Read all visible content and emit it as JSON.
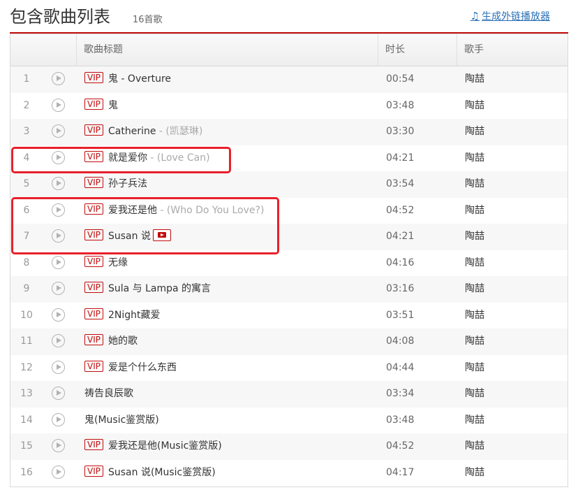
{
  "header": {
    "title": "包含歌曲列表",
    "count": "16首歌",
    "external_player_link": "生成外链播放器"
  },
  "table": {
    "columns": [
      "",
      "歌曲标题",
      "时长",
      "歌手"
    ],
    "vip_badge": "VIP",
    "rows": [
      {
        "num": "1",
        "vip": true,
        "title": "鬼 - Overture",
        "alias": "",
        "mv": false,
        "duration": "00:54",
        "artist": "陶喆"
      },
      {
        "num": "2",
        "vip": true,
        "title": "鬼",
        "alias": "",
        "mv": false,
        "duration": "03:48",
        "artist": "陶喆"
      },
      {
        "num": "3",
        "vip": true,
        "title": "Catherine",
        "alias": " - (凯瑟琳)",
        "mv": false,
        "duration": "03:30",
        "artist": "陶喆"
      },
      {
        "num": "4",
        "vip": true,
        "title": "就是爱你",
        "alias": " - (Love Can)",
        "mv": false,
        "duration": "04:21",
        "artist": "陶喆"
      },
      {
        "num": "5",
        "vip": true,
        "title": "孙子兵法",
        "alias": "",
        "mv": false,
        "duration": "03:54",
        "artist": "陶喆"
      },
      {
        "num": "6",
        "vip": true,
        "title": "爱我还是他",
        "alias": " - (Who Do You Love?)",
        "mv": false,
        "duration": "04:52",
        "artist": "陶喆"
      },
      {
        "num": "7",
        "vip": true,
        "title": "Susan 说",
        "alias": "",
        "mv": true,
        "duration": "04:21",
        "artist": "陶喆"
      },
      {
        "num": "8",
        "vip": true,
        "title": "无缘",
        "alias": "",
        "mv": false,
        "duration": "04:16",
        "artist": "陶喆"
      },
      {
        "num": "9",
        "vip": true,
        "title": "Sula 与 Lampa 的寓言",
        "alias": "",
        "mv": false,
        "duration": "03:16",
        "artist": "陶喆"
      },
      {
        "num": "10",
        "vip": true,
        "title": "2Night藏爱",
        "alias": "",
        "mv": false,
        "duration": "03:51",
        "artist": "陶喆"
      },
      {
        "num": "11",
        "vip": true,
        "title": "她的歌",
        "alias": "",
        "mv": false,
        "duration": "04:08",
        "artist": "陶喆"
      },
      {
        "num": "12",
        "vip": true,
        "title": "爱是个什么东西",
        "alias": "",
        "mv": false,
        "duration": "04:44",
        "artist": "陶喆"
      },
      {
        "num": "13",
        "vip": false,
        "title": "祷告良辰歌",
        "alias": "",
        "mv": false,
        "duration": "03:34",
        "artist": "陶喆"
      },
      {
        "num": "14",
        "vip": false,
        "title": "鬼(Music鉴赏版)",
        "alias": "",
        "mv": false,
        "duration": "03:48",
        "artist": "陶喆"
      },
      {
        "num": "15",
        "vip": true,
        "title": "爱我还是他(Music鉴赏版)",
        "alias": "",
        "mv": false,
        "duration": "04:52",
        "artist": "陶喆"
      },
      {
        "num": "16",
        "vip": true,
        "title": "Susan 说(Music鉴赏版)",
        "alias": "",
        "mv": false,
        "duration": "04:17",
        "artist": "陶喆"
      }
    ]
  },
  "colors": {
    "accent": "#c20c0c",
    "highlight_box": "#e8202a",
    "link": "#2b70b7"
  }
}
